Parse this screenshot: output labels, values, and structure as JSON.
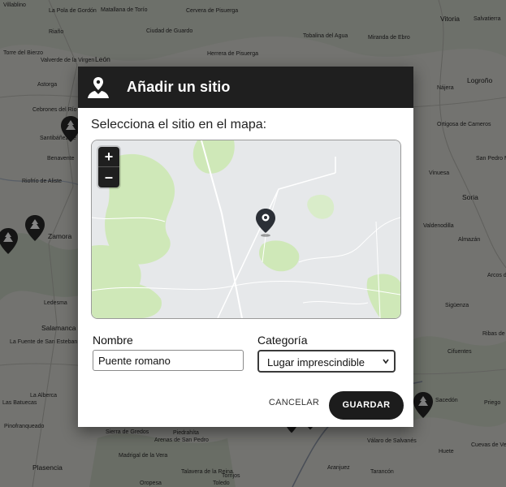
{
  "background_map": {
    "places": [
      {
        "name": "Villablino",
        "id": "villablino"
      },
      {
        "name": "La Pola de Gordón",
        "id": "la-pola-de-gordon"
      },
      {
        "name": "Matallana de Torío",
        "id": "matallana-de-torio"
      },
      {
        "name": "Cervera de Pisuerga",
        "id": "cervera-de-pisuerga"
      },
      {
        "name": "Riaño",
        "id": "riano"
      },
      {
        "name": "Ciudad de Guardo",
        "id": "guardo"
      },
      {
        "name": "Torre del Bierzo",
        "id": "torre-del-bierzo"
      },
      {
        "name": "Valverde de la Virgen",
        "id": "valverde-de-la-virgen"
      },
      {
        "name": "León",
        "id": "leon"
      },
      {
        "name": "Herrera de Pisuerga",
        "id": "herrera-de-pisuerga"
      },
      {
        "name": "Tobalina del Agua",
        "id": "tobalina"
      },
      {
        "name": "Miranda de Ebro",
        "id": "miranda-de-ebro"
      },
      {
        "name": "Vitoria",
        "id": "vitoria"
      },
      {
        "name": "Salvatierra",
        "id": "salvatierra"
      },
      {
        "name": "Logroño",
        "id": "logrono"
      },
      {
        "name": "Nájera",
        "id": "najera"
      },
      {
        "name": "Astorga",
        "id": "astorga"
      },
      {
        "name": "Cebrones del Río",
        "id": "cebrones-del-rio"
      },
      {
        "name": "Santibáñez de Vidriales",
        "id": "santibanez-de-vidriales"
      },
      {
        "name": "Benavente",
        "id": "benavente"
      },
      {
        "name": "Ortigosa de Cameros",
        "id": "ortigosa"
      },
      {
        "name": "San Pedro Manrique",
        "id": "san-pedro-manrique"
      },
      {
        "name": "Vinuesa",
        "id": "vinuesa"
      },
      {
        "name": "Soria",
        "id": "soria"
      },
      {
        "name": "Riofrío de Aliste",
        "id": "riofrio-de-aliste"
      },
      {
        "name": "Zamora",
        "id": "zamora"
      },
      {
        "name": "Valdenodilla",
        "id": "valdenodilla"
      },
      {
        "name": "Almazán",
        "id": "almazan"
      },
      {
        "name": "Arcos de Jalón",
        "id": "arcos-de-jalon"
      },
      {
        "name": "Ledesma",
        "id": "ledesma"
      },
      {
        "name": "Salamanca",
        "id": "salamanca"
      },
      {
        "name": "Sigüenza",
        "id": "siguenza"
      },
      {
        "name": "La Fuente de San Esteban",
        "id": "la-fuente-de-san-esteban"
      },
      {
        "name": "Ribas de Saelices",
        "id": "ribas-de-saelices"
      },
      {
        "name": "Cifuentes",
        "id": "cifuentes"
      },
      {
        "name": "La Alberca",
        "id": "la-alberca"
      },
      {
        "name": "Las Batuecas",
        "id": "las-batuecas"
      },
      {
        "name": "Piedrahíta",
        "id": "piedrahita"
      },
      {
        "name": "Pinofranqueado",
        "id": "pinofranqueado"
      },
      {
        "name": "Sierra de Gredos",
        "id": "sierra-de-gredos"
      },
      {
        "name": "Arenas de San Pedro",
        "id": "arenas-de-san-pedro"
      },
      {
        "name": "Válaro de Salvanés",
        "id": "valaro-de-salvanes"
      },
      {
        "name": "Sacedón",
        "id": "sacedon"
      },
      {
        "name": "Priego",
        "id": "priego"
      },
      {
        "name": "Huete",
        "id": "huete"
      },
      {
        "name": "Cuevas de Velasco",
        "id": "cuevas-de-velasco"
      },
      {
        "name": "Madrigal de la Vera",
        "id": "madrigal-de-la-vera"
      },
      {
        "name": "Plasencia",
        "id": "plasencia"
      },
      {
        "name": "Talavera de la Reina",
        "id": "talavera-de-la-reina"
      },
      {
        "name": "Torrijos",
        "id": "torrijos"
      },
      {
        "name": "Aranjuez",
        "id": "aranjuez"
      },
      {
        "name": "Tarancón",
        "id": "tarancon"
      },
      {
        "name": "Oropesa",
        "id": "oropesa"
      },
      {
        "name": "Toledo",
        "id": "toledo"
      }
    ]
  },
  "dialog": {
    "title": "Añadir un sitio",
    "header_icon": "user-location-icon",
    "subtitle": "Selecciona el sitio en el mapa:",
    "map": {
      "zoom_in": "+",
      "zoom_out": "–",
      "pin_icon": "map-pin-icon"
    },
    "name_label": "Nombre",
    "name_value": "Puente romano",
    "category_label": "Categoría",
    "category_selected": "Lugar imprescindible",
    "cancel_label": "CANCELAR",
    "save_label": "GUARDAR"
  },
  "colors": {
    "header_bg": "#1f1f1f",
    "save_button_bg": "#1c1c1c",
    "map_green": "#cfe8b8",
    "map_road": "#ffffff",
    "overlay": "rgba(0,0,0,0.48)"
  }
}
